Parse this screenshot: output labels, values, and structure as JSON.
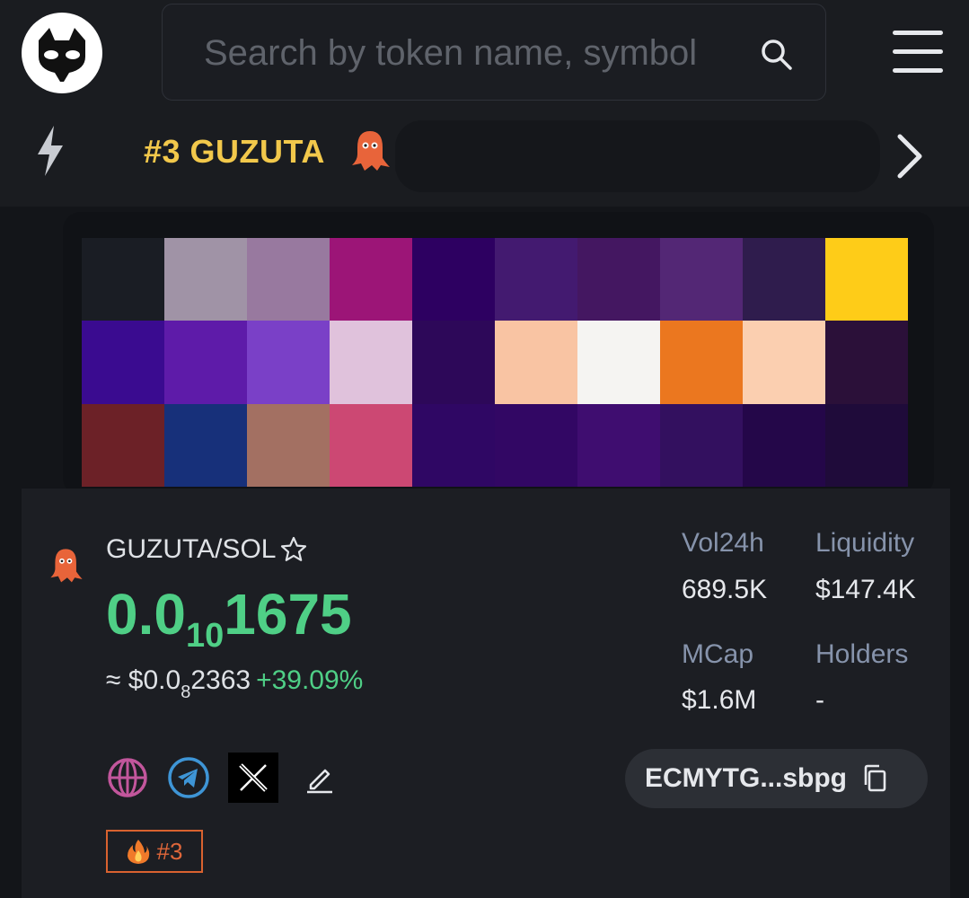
{
  "header": {
    "search_placeholder": "Search by token name, symbol"
  },
  "ticker": {
    "title": "#3 GUZUTA"
  },
  "banner": {
    "cells": [
      "#1a1d24",
      "#a093a6",
      "#98799f",
      "#9c1577",
      "#2d0061",
      "#431a70",
      "#441761",
      "#532775",
      "#2f1c4d",
      "#fecc18",
      "#3a0b90",
      "#5e1ba9",
      "#7a40c7",
      "#e0c2dc",
      "#2d0859",
      "#f9c4a3",
      "#f5f4f2",
      "#eb771f",
      "#fbcfb0",
      "#2b1039",
      "#6c2127",
      "#17307a",
      "#a37062",
      "#cc4873",
      "#2f0764",
      "#320764",
      "#3f0d70",
      "#33105f",
      "#240749",
      "#1f0b3a"
    ]
  },
  "token": {
    "pair": "GUZUTA/SOL",
    "price_prefix": "0.0",
    "price_zeros": "10",
    "price_digits": "1675",
    "usd_prefix": "≈ $0.0",
    "usd_zeros": "8",
    "usd_digits": "2363",
    "change": "+39.09%",
    "stats": {
      "vol_label": "Vol24h",
      "vol_value": "689.5K",
      "liq_label": "Liquidity",
      "liq_value": "$147.4K",
      "mcap_label": "MCap",
      "mcap_value": "$1.6M",
      "holders_label": "Holders",
      "holders_value": "-"
    },
    "address": "ECMYTG...sbpg",
    "rank_label": "#3"
  },
  "colors": {
    "accent_green": "#4fcf86",
    "ticker_gold": "#f2c84b",
    "stat_label": "#8693ab",
    "rank_orange": "#e0673a"
  },
  "icons": [
    "logo-icon",
    "search-icon",
    "menu-icon",
    "bolt-icon",
    "ghost-icon",
    "chevron-right-icon",
    "star-icon",
    "globe-icon",
    "telegram-icon",
    "x-icon",
    "edit-icon",
    "copy-icon",
    "fire-icon"
  ]
}
